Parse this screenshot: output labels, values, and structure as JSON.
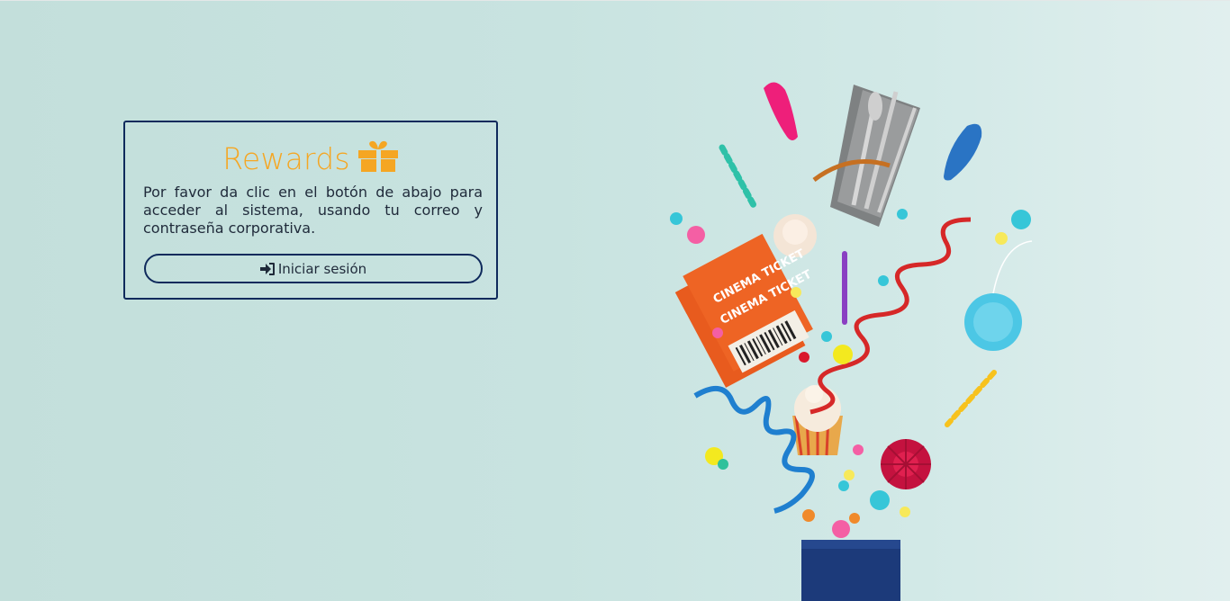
{
  "card": {
    "title": "Rewards",
    "title_icon": "gift-icon",
    "description": "Por favor da clic en el botón de abajo para acceder al sistema, usando tu correo y contraseña corporativa.",
    "login_button": {
      "label": "Iniciar sesión",
      "icon": "sign-in-icon"
    }
  },
  "colors": {
    "accent": "#f5a623",
    "navy": "#0f2a5c",
    "text": "#1f2a3a",
    "background": "#c6e1de"
  },
  "illustration": {
    "ticket_text_1": "CINEMA TICKET",
    "ticket_text_2": "CINEMA TICKET"
  }
}
